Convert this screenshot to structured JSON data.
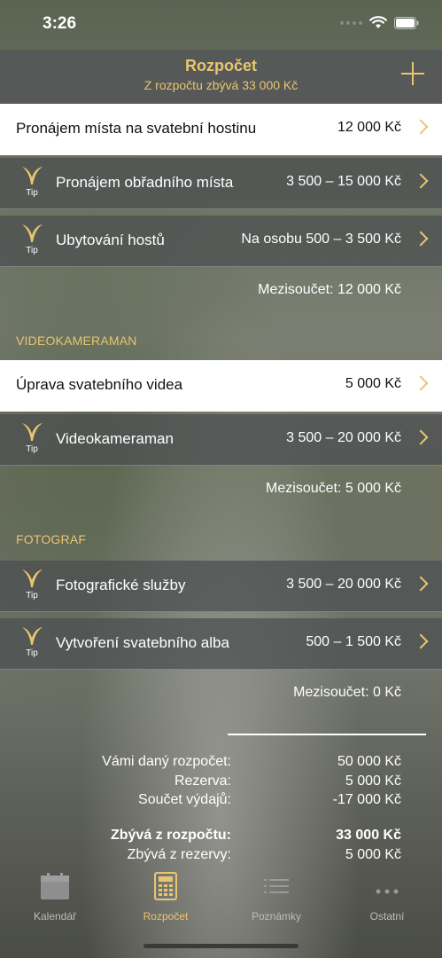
{
  "status": {
    "time": "3:26"
  },
  "nav": {
    "title": "Rozpočet",
    "subtitle": "Z rozpočtu zbývá 33 000 Kč"
  },
  "tip_label": "Tip",
  "venue_rows": [
    {
      "label": "Pronájem místa na svatební hostinu",
      "value": "12 000 Kč",
      "style": "white"
    },
    {
      "label": "Pronájem obřadního místa",
      "value": "3 500 – 15 000 Kč",
      "style": "tip"
    },
    {
      "label": "Ubytování hostů",
      "value": "Na osobu 500 – 3 500 Kč",
      "style": "tip"
    }
  ],
  "venue_subtotal": "Mezisoučet:   12 000 Kč",
  "video": {
    "section": "VIDEOKAMERAMAN",
    "rows": [
      {
        "label": "Úprava svatebního videa",
        "value": "5 000 Kč"
      },
      {
        "label": "Videokameraman",
        "value": "3 500 – 20 000 Kč"
      }
    ],
    "subtotal": "Mezisoučet:   5 000 Kč"
  },
  "photo": {
    "section": "FOTOGRAF",
    "rows": [
      {
        "label": "Fotografické služby",
        "value": "3 500 – 20 000 Kč"
      },
      {
        "label": "Vytvoření svatebního alba",
        "value": "500 – 1 500 Kč"
      }
    ],
    "subtotal": "Mezisoučet:   0 Kč"
  },
  "summary": [
    {
      "label": "Vámi daný rozpočet:",
      "value": "50 000 Kč"
    },
    {
      "label": "Rezerva:",
      "value": "5 000 Kč"
    },
    {
      "label": "Součet výdajů:",
      "value": "-17 000 Kč"
    },
    {
      "label": "Zbývá z rozpočtu:",
      "value": "33 000 Kč"
    },
    {
      "label": "Zbývá z rezervy:",
      "value": "5 000 Kč"
    }
  ],
  "tabs": [
    {
      "label": "Kalendář",
      "icon": "calendar-icon",
      "active": false
    },
    {
      "label": "Rozpočet",
      "icon": "calculator-icon",
      "active": true
    },
    {
      "label": "Poznámky",
      "icon": "list-icon",
      "active": false
    },
    {
      "label": "Ostatní",
      "icon": "more-icon",
      "active": false
    }
  ],
  "colors": {
    "accent": "#e9c56f",
    "nav_bg": "#555858",
    "row_dark": "#4b4e50"
  }
}
